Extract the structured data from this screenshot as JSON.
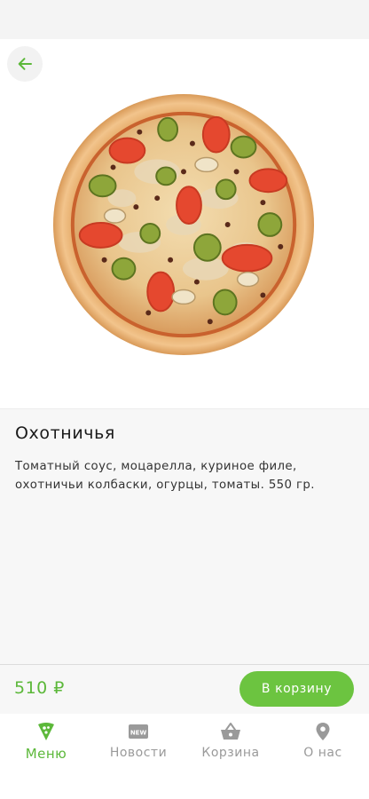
{
  "colors": {
    "accent": "#6cc440",
    "accent_text": "#5cb83a",
    "inactive": "#9a9a9a",
    "panel_bg": "#f7f7f7"
  },
  "header": {
    "back_icon": "arrow-left-icon"
  },
  "product": {
    "image_icon": "pizza-photo",
    "name": "Охотничья",
    "description": "Томатный соус, моцарелла, куриное филе, охотничьи колбаски, огурцы, томаты. 550 гр.",
    "price": "510 ₽",
    "add_to_cart_label": "В корзину"
  },
  "tabs": [
    {
      "label": "Меню",
      "icon": "pizza-slice-icon",
      "active": true
    },
    {
      "label": "Новости",
      "icon": "new-badge-icon",
      "active": false
    },
    {
      "label": "Корзина",
      "icon": "basket-icon",
      "active": false
    },
    {
      "label": "О нас",
      "icon": "location-pin-icon",
      "active": false
    }
  ]
}
